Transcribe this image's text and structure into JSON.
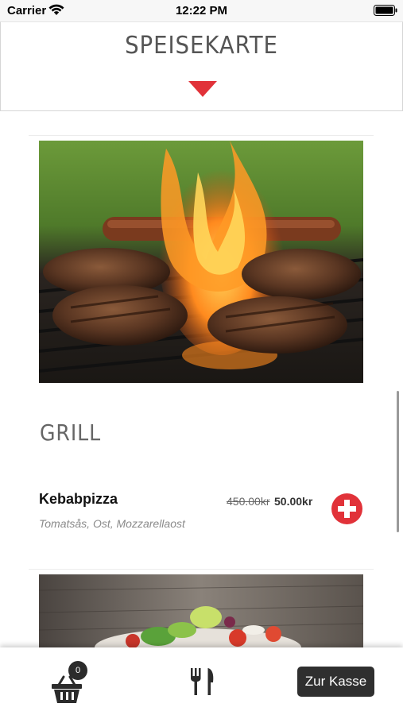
{
  "status_bar": {
    "carrier": "Carrier",
    "time": "12:22 PM"
  },
  "header": {
    "title": "SPEISEKARTE"
  },
  "section": {
    "title": "GRILL"
  },
  "menu_item": {
    "name": "Kebabpizza",
    "description": "Tomatsås, Ost, Mozzarellaost",
    "price_old": "450.00kr",
    "price_new": "50.00kr"
  },
  "tabbar": {
    "cart_count": "0",
    "checkout_label": "Zur Kasse"
  },
  "colors": {
    "accent": "#e13239",
    "dark": "#2f2f2f"
  }
}
